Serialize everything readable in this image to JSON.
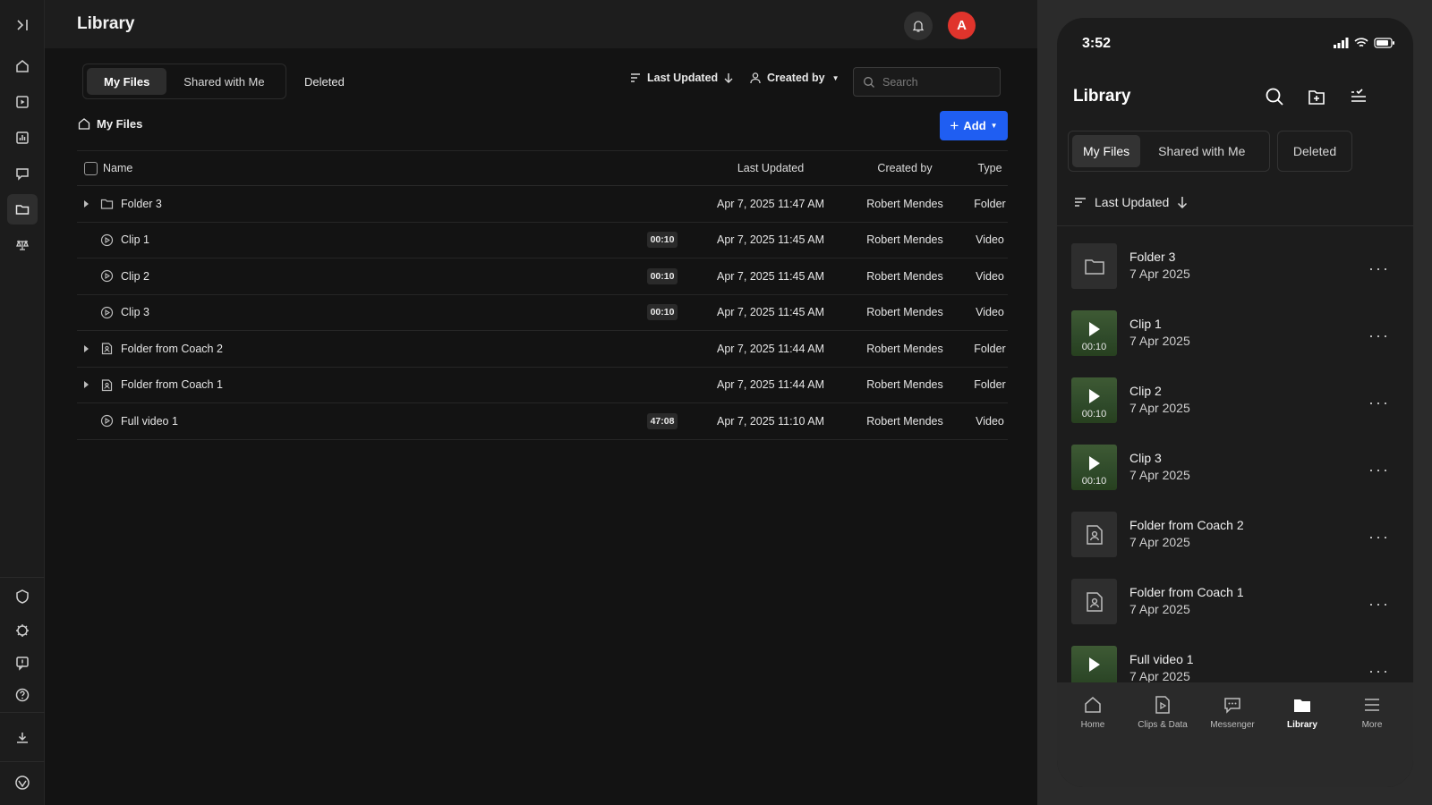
{
  "desktop": {
    "title": "Library",
    "avatar_initial": "A",
    "tabs": [
      {
        "label": "My Files",
        "active": true
      },
      {
        "label": "Shared with Me",
        "active": false
      }
    ],
    "deleted_tab": "Deleted",
    "sort_label": "Last Updated",
    "created_by_label": "Created by",
    "search_placeholder": "Search",
    "breadcrumb": "My Files",
    "add_label": "Add",
    "columns": {
      "name": "Name",
      "updated": "Last Updated",
      "created": "Created by",
      "type": "Type"
    },
    "rows": [
      {
        "name": "Folder 3",
        "kind": "folder",
        "duration": "",
        "updated": "Apr 7, 2025 11:47 AM",
        "created_by": "Robert Mendes",
        "type": "Folder"
      },
      {
        "name": "Clip 1",
        "kind": "video",
        "duration": "00:10",
        "updated": "Apr 7, 2025 11:45 AM",
        "created_by": "Robert Mendes",
        "type": "Video"
      },
      {
        "name": "Clip 2",
        "kind": "video",
        "duration": "00:10",
        "updated": "Apr 7, 2025 11:45 AM",
        "created_by": "Robert Mendes",
        "type": "Video"
      },
      {
        "name": "Clip 3",
        "kind": "video",
        "duration": "00:10",
        "updated": "Apr 7, 2025 11:45 AM",
        "created_by": "Robert Mendes",
        "type": "Video"
      },
      {
        "name": "Folder from Coach 2",
        "kind": "shared-folder",
        "duration": "",
        "updated": "Apr 7, 2025 11:44 AM",
        "created_by": "Robert Mendes",
        "type": "Folder"
      },
      {
        "name": "Folder from Coach 1",
        "kind": "shared-folder",
        "duration": "",
        "updated": "Apr 7, 2025 11:44 AM",
        "created_by": "Robert Mendes",
        "type": "Folder"
      },
      {
        "name": "Full video 1",
        "kind": "video",
        "duration": "47:08",
        "updated": "Apr 7, 2025 11:10 AM",
        "created_by": "Robert Mendes",
        "type": "Video"
      }
    ]
  },
  "mobile": {
    "time": "3:52",
    "title": "Library",
    "tabs": [
      {
        "label": "My Files",
        "active": true
      },
      {
        "label": "Shared with Me",
        "active": false
      }
    ],
    "deleted_tab": "Deleted",
    "sort_label": "Last Updated",
    "items": [
      {
        "name": "Folder 3",
        "date": "7 Apr 2025",
        "kind": "folder",
        "duration": ""
      },
      {
        "name": "Clip 1",
        "date": "7 Apr 2025",
        "kind": "video",
        "duration": "00:10"
      },
      {
        "name": "Clip 2",
        "date": "7 Apr 2025",
        "kind": "video",
        "duration": "00:10"
      },
      {
        "name": "Clip 3",
        "date": "7 Apr 2025",
        "kind": "video",
        "duration": "00:10"
      },
      {
        "name": "Folder from Coach 2",
        "date": "7 Apr 2025",
        "kind": "shared-folder",
        "duration": ""
      },
      {
        "name": "Folder from Coach 1",
        "date": "7 Apr 2025",
        "kind": "shared-folder",
        "duration": ""
      },
      {
        "name": "Full video 1",
        "date": "7 Apr 2025",
        "kind": "video",
        "duration": ""
      }
    ],
    "nav": [
      {
        "label": "Home",
        "icon": "home-icon",
        "active": false
      },
      {
        "label": "Clips & Data",
        "icon": "clips-icon",
        "active": false
      },
      {
        "label": "Messenger",
        "icon": "messenger-icon",
        "active": false
      },
      {
        "label": "Library",
        "icon": "library-icon",
        "active": true
      },
      {
        "label": "More",
        "icon": "menu-icon",
        "active": false
      }
    ]
  },
  "colors": {
    "accent": "#1f5ef2",
    "avatar": "#e0342c",
    "background": "#131313"
  }
}
